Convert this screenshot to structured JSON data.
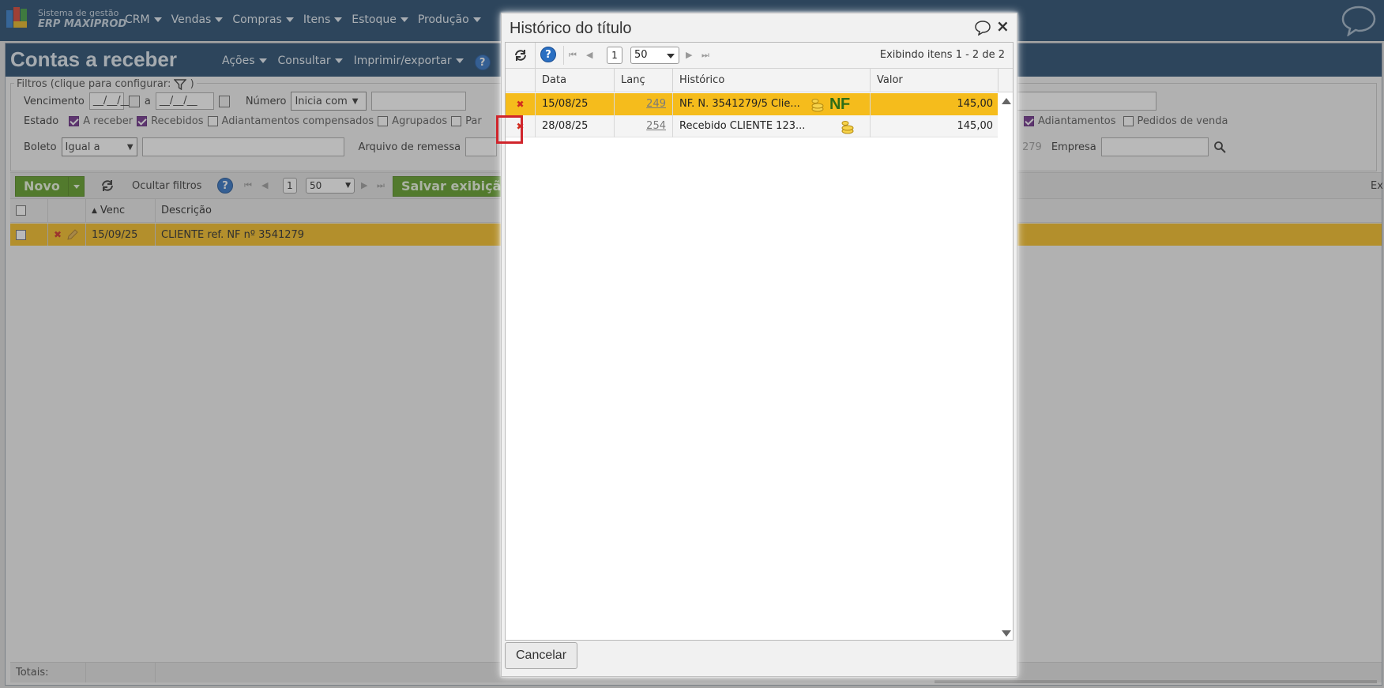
{
  "app": {
    "logo_line1": "Sistema de gestão",
    "logo_line2": "ERP MAXIPROD",
    "menu": [
      "CRM",
      "Vendas",
      "Compras",
      "Itens",
      "Estoque",
      "Produção"
    ]
  },
  "page": {
    "title": "Contas a receber",
    "submenu": [
      "Ações",
      "Consultar",
      "Imprimir/exportar"
    ],
    "help": "?"
  },
  "filters": {
    "legend": "Filtros (clique para configurar:",
    "legend_end": ")",
    "vencimento_label": "Vencimento",
    "date_from": "__/__/__",
    "date_sep": "a",
    "date_to": "__/__/__",
    "numero_label": "Número",
    "numero_select": "Inicia com",
    "estado_label": "Estado",
    "estado_checks": [
      {
        "label": "A receber",
        "checked": true
      },
      {
        "label": "Recebidos",
        "checked": true
      },
      {
        "label": "Adiantamentos compensados",
        "checked": false
      },
      {
        "label": "Agrupados",
        "checked": false
      },
      {
        "label": "Par",
        "checked": false
      }
    ],
    "right_checks": [
      {
        "label": "Adiantamentos",
        "checked": true
      },
      {
        "label": "Pedidos de venda",
        "checked": false
      }
    ],
    "boleto_label": "Boleto",
    "boleto_select": "Igual a",
    "remessa_label": "Arquivo de remessa",
    "partial_value": "279",
    "empresa_label": "Empresa"
  },
  "toolbar": {
    "novo": "Novo",
    "ocultar": "Ocultar filtros",
    "page": "1",
    "page_size": "50",
    "salvar": "Salvar exibição",
    "right_partial": "Ex"
  },
  "grid": {
    "col_venc": "Venc",
    "col_desc": "Descrição",
    "row": {
      "venc": "15/09/25",
      "desc": "CLIENTE ref. NF nº 3541279"
    },
    "totais": "Totais:"
  },
  "modal": {
    "title": "Histórico do título",
    "page": "1",
    "page_size": "50",
    "range": "Exibindo itens 1 - 2 de 2",
    "help": "?",
    "columns": [
      "Data",
      "Lanç",
      "Histórico",
      "Valor"
    ],
    "rows": [
      {
        "data": "15/08/25",
        "lanc": "249",
        "historico": "NF. N. 3541279/5 Clie...",
        "badge": "NF",
        "valor": "145,00"
      },
      {
        "data": "28/08/25",
        "lanc": "254",
        "historico": "Recebido CLIENTE 123...",
        "badge": "",
        "valor": "145,00"
      }
    ],
    "cancel": "Cancelar"
  },
  "colors": {
    "nav": "#1d4469",
    "highlight_row": "#f5bc1c",
    "green_button": "#5a9a1e",
    "annotation_red": "#d0252c"
  }
}
